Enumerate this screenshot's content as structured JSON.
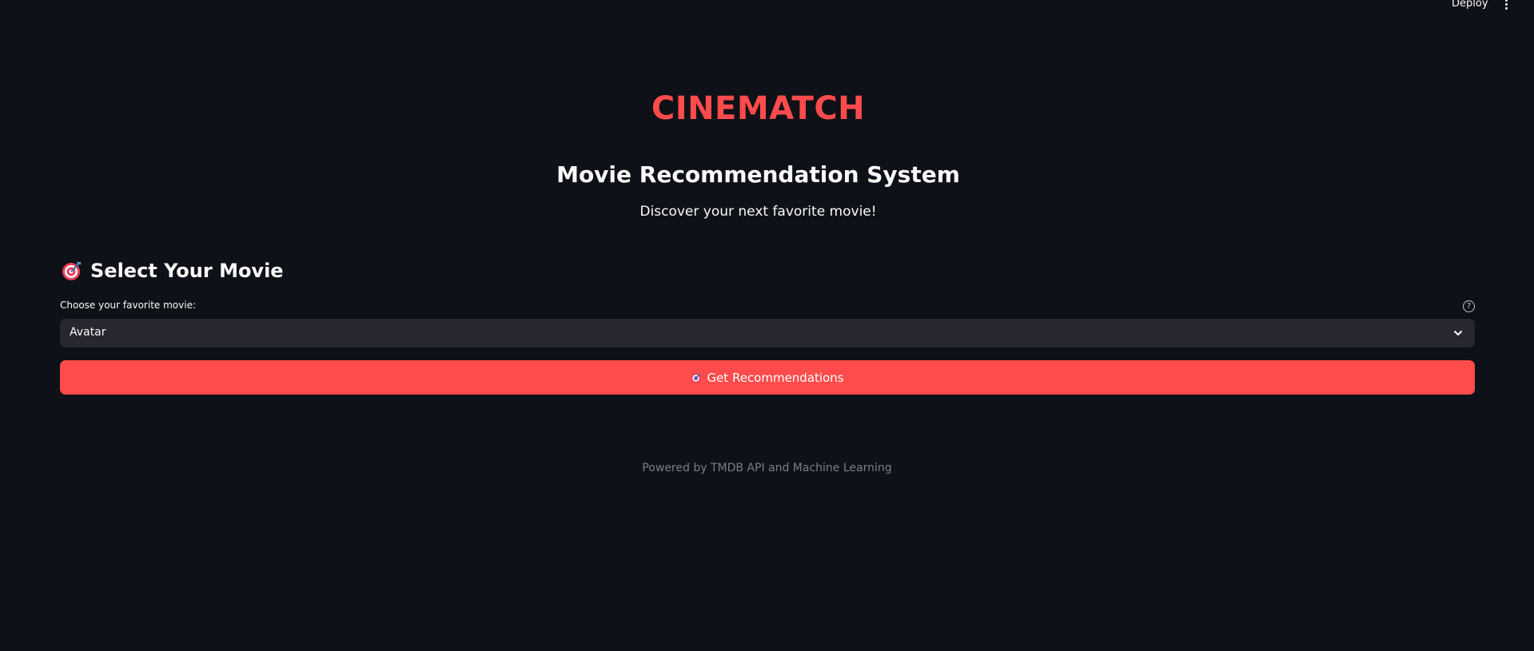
{
  "topbar": {
    "deploy_label": "Deploy",
    "menu_icon": "kebab-menu-icon"
  },
  "header": {
    "title": "CINEMATCH",
    "subtitle": "Movie Recommendation System",
    "tagline": "Discover your next favorite movie!"
  },
  "section": {
    "icon": "target-icon",
    "title": "Select Your Movie"
  },
  "movie_select": {
    "label": "Choose your favorite movie:",
    "help_icon": "question-circle-icon",
    "selected": "Avatar"
  },
  "recommend_button": {
    "icon": "target-icon",
    "label": "Get Recommendations"
  },
  "footer": {
    "text": "Powered by TMDB API and Machine Learning"
  },
  "colors": {
    "background": "#0e1117",
    "accent": "#ff4b4b",
    "select_bg": "#262730",
    "muted_text": "#7a7e87"
  }
}
